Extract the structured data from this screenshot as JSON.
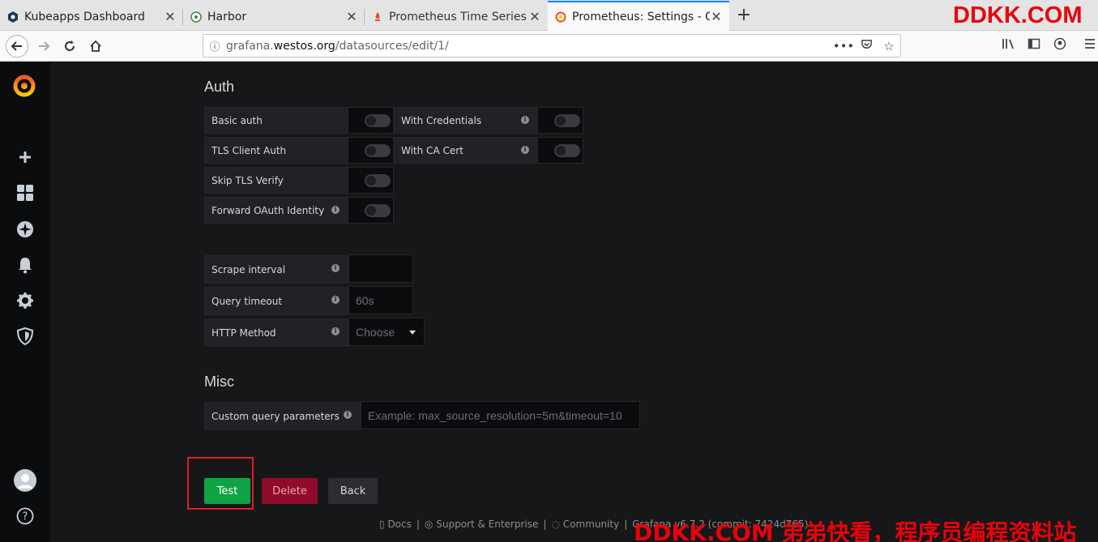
{
  "browser": {
    "tabs": [
      {
        "title": "Kubeapps Dashboard"
      },
      {
        "title": "Harbor"
      },
      {
        "title": "Prometheus Time Series C"
      },
      {
        "title": "Prometheus: Settings - G"
      }
    ],
    "url_prefix": "grafana.",
    "url_domain": "westos.org",
    "url_path": "/datasources/edit/1/"
  },
  "watermark": {
    "top": "DDKK.COM",
    "bottom": "DDKK.COM 弟弟快看，程序员编程资料站"
  },
  "auth": {
    "title": "Auth",
    "basic_auth": "Basic auth",
    "with_credentials": "With Credentials",
    "tls_client_auth": "TLS Client Auth",
    "with_ca_cert": "With CA Cert",
    "skip_tls_verify": "Skip TLS Verify",
    "forward_oauth": "Forward OAuth Identity"
  },
  "settings": {
    "scrape_interval": "Scrape interval",
    "scrape_interval_value": "",
    "query_timeout": "Query timeout",
    "query_timeout_placeholder": "60s",
    "http_method": "HTTP Method",
    "http_method_placeholder": "Choose"
  },
  "misc": {
    "title": "Misc",
    "custom_query": "Custom query parameters",
    "custom_query_placeholder": "Example: max_source_resolution=5m&timeout=10"
  },
  "buttons": {
    "test": "Test",
    "delete": "Delete",
    "back": "Back"
  },
  "footer": {
    "docs": "Docs",
    "support": "Support & Enterprise",
    "community": "Community",
    "grafana": "Grafana v6.7.2 (commit: 7424d765)"
  },
  "colors": {
    "accent": "#10a345",
    "danger": "#8f0b29",
    "highlight": "#e02020",
    "watermark": "#e8000b"
  }
}
